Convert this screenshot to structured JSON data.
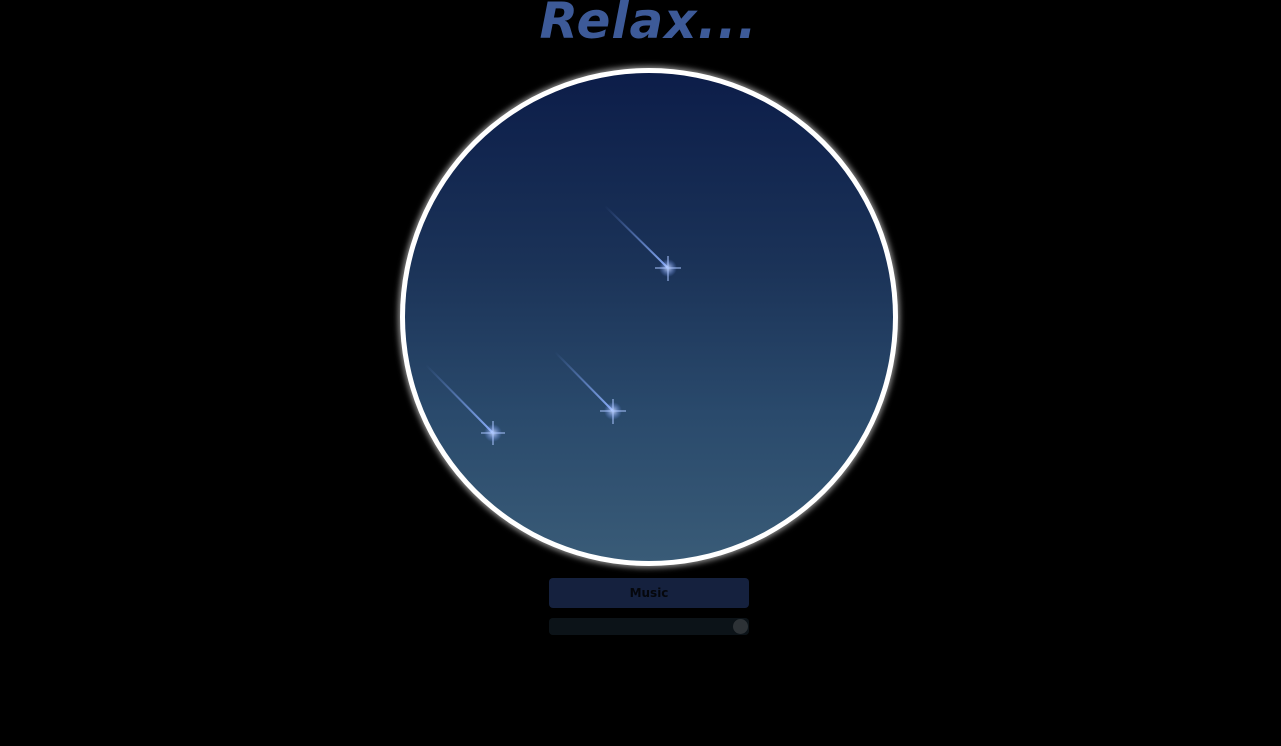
{
  "header": {
    "title": "Relax..."
  },
  "scene": {
    "icon": "shooting-stars-illustration",
    "shooting_star_count": 3,
    "colors": {
      "sky_top": "#0c1d49",
      "sky_bottom": "#395b77",
      "ring": "#ffffff",
      "star": "#7fa6ff"
    }
  },
  "controls": {
    "music_label": "Music",
    "volume_fraction": 1.0
  },
  "colors": {
    "background": "#000000",
    "title": "#3d5a98",
    "button_bg": "#15213e",
    "slider_bg": "#0c1318"
  }
}
